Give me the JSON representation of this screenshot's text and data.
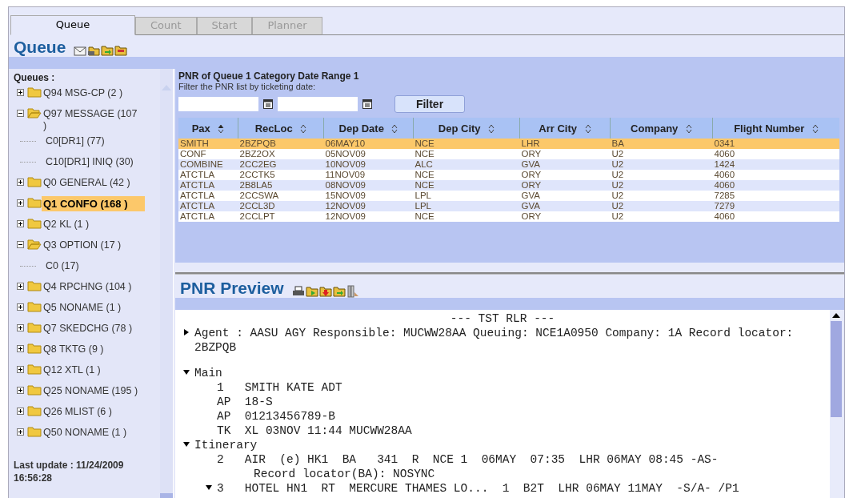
{
  "tabs": [
    {
      "label": "Queue",
      "selected": true
    },
    {
      "label": "Count",
      "selected": false
    },
    {
      "label": "Start",
      "selected": false
    },
    {
      "label": "Planner",
      "selected": false
    }
  ],
  "queue_panel": {
    "title": "Queue",
    "label": "Queues :",
    "tree": [
      {
        "label": "Q94 MSG-CP (2 )",
        "expanded": false,
        "selected": false
      },
      {
        "label": "Q97 MESSAGE (107 )",
        "expanded": true,
        "selected": false,
        "children": [
          {
            "label": "C0[DR1] (77)"
          },
          {
            "label": "C10[DR1] INIQ (30)"
          }
        ]
      },
      {
        "label": "Q0 GENERAL (42 )",
        "expanded": false,
        "selected": false
      },
      {
        "label": "Q1 CONFO (168 )",
        "expanded": false,
        "selected": true
      },
      {
        "label": "Q2 KL (1 )",
        "expanded": false,
        "selected": false
      },
      {
        "label": "Q3 OPTION (17 )",
        "expanded": true,
        "selected": false,
        "children": [
          {
            "label": "C0 (17)"
          }
        ]
      },
      {
        "label": "Q4 RPCHNG (104 )",
        "expanded": false,
        "selected": false
      },
      {
        "label": "Q5 NONAME (1 )",
        "expanded": false,
        "selected": false
      },
      {
        "label": "Q7 SKEDCHG (78 )",
        "expanded": false,
        "selected": false
      },
      {
        "label": "Q8 TKTG (9 )",
        "expanded": false,
        "selected": false
      },
      {
        "label": "Q12 XTL (1 )",
        "expanded": false,
        "selected": false
      },
      {
        "label": "Q25 NONAME (195 )",
        "expanded": false,
        "selected": false
      },
      {
        "label": "Q26 MLIST (6 )",
        "expanded": false,
        "selected": false
      },
      {
        "label": "Q50 NONAME (1 )",
        "expanded": false,
        "selected": false
      }
    ],
    "last_update": "Last update : 11/24/2009 16:56:28"
  },
  "pnr_list": {
    "title": "PNR of Queue 1 Category Date Range 1",
    "hint": "Filter the PNR list by ticketing date:",
    "filter_button": "Filter",
    "columns": [
      {
        "label": "Pax",
        "sorted": true
      },
      {
        "label": "RecLoc",
        "sorted": false
      },
      {
        "label": "Dep Date",
        "sorted": false
      },
      {
        "label": "Dep City",
        "sorted": false
      },
      {
        "label": "Arr City",
        "sorted": false
      },
      {
        "label": "Company",
        "sorted": false
      },
      {
        "label": "Flight Number",
        "sorted": false
      }
    ],
    "rows": [
      {
        "selected": true,
        "cells": [
          "SMITH",
          "2BZPQB",
          "06MAY10",
          "NCE",
          "LHR",
          "BA",
          "0341"
        ]
      },
      {
        "selected": false,
        "cells": [
          "CONF",
          "2BZ2OX",
          "05NOV09",
          "NCE",
          "ORY",
          "U2",
          "4060"
        ]
      },
      {
        "selected": false,
        "cells": [
          "COMBINE",
          "2CC2EG",
          "10NOV09",
          "ALC",
          "GVA",
          "U2",
          "1424"
        ]
      },
      {
        "selected": false,
        "cells": [
          "ATCTLA",
          "2CCTK5",
          "11NOV09",
          "NCE",
          "ORY",
          "U2",
          "4060"
        ]
      },
      {
        "selected": false,
        "cells": [
          "ATCTLA",
          "2B8LA5",
          "08NOV09",
          "NCE",
          "ORY",
          "U2",
          "4060"
        ]
      },
      {
        "selected": false,
        "cells": [
          "ATCTLA",
          "2CCSWA",
          "15NOV09",
          "LPL",
          "GVA",
          "U2",
          "7285"
        ]
      },
      {
        "selected": false,
        "cells": [
          "ATCTLA",
          "2CCL3D",
          "12NOV09",
          "LPL",
          "GVA",
          "U2",
          "7279"
        ]
      },
      {
        "selected": false,
        "cells": [
          "ATCTLA",
          "2CCLPT",
          "12NOV09",
          "NCE",
          "ORY",
          "U2",
          "4060"
        ]
      }
    ]
  },
  "preview": {
    "title": "PNR Preview",
    "header": "--- TST RLR ---",
    "sections": [
      {
        "label": "Agent : AASU AGY Responsible: MUCWW28AA Queuing: NCE1A0950 Company: 1A Record locator: 2BZPQB",
        "expanded": false
      },
      {
        "label": "Main",
        "expanded": true,
        "children": [
          {
            "text": "1   SMITH KATE ADT"
          },
          {
            "text": "AP  18-S"
          },
          {
            "text": "AP  01213456789-B"
          },
          {
            "text": "TK  XL 03NOV 11:44 MUCWW28AA"
          }
        ]
      },
      {
        "label": "Itinerary",
        "expanded": true,
        "children": [
          {
            "text": "2   AIR  (e) HK1  BA   341  R  NCE 1  06MAY  07:35  LHR 06MAY 08:45 -AS-",
            "children": [
              {
                "text": "Record locator(BA): NOSYNC"
              }
            ]
          },
          {
            "text": "3   HOTEL HN1  RT  MERCURE THAMES LO...  1  B2T  LHR 06MAY 11MAY  -S/A- /P1",
            "expanded": true
          }
        ]
      }
    ]
  }
}
